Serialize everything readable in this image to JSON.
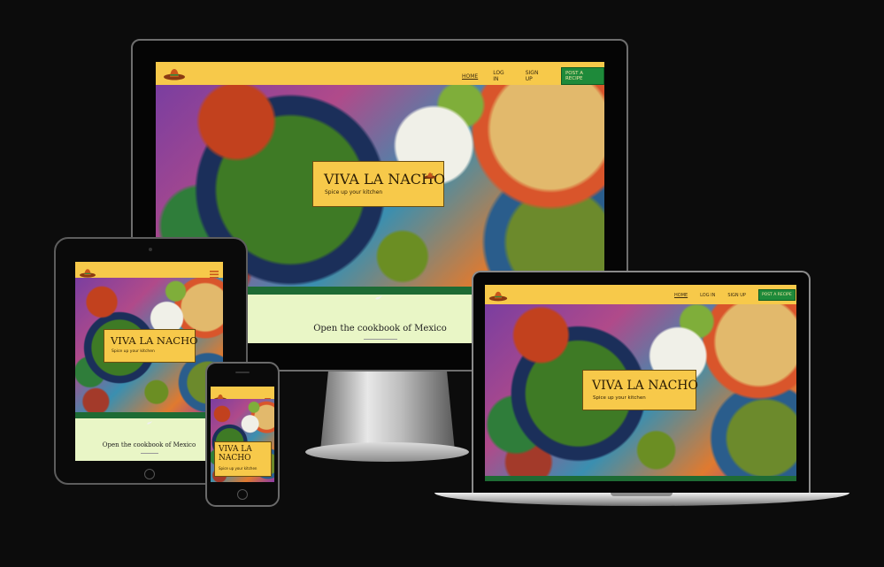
{
  "site": {
    "nav": {
      "home": "HOME",
      "login": "LOG IN",
      "signup": "SIGN UP",
      "post": "POST A RECIPE"
    },
    "hero": {
      "title": "VIVA LA NACHO",
      "title_line1": "VIVA LA",
      "title_line2": "NACHO",
      "subtitle": "Spice up your kitchen"
    },
    "tagline": "Open the cookbook of Mexico"
  },
  "icons": {
    "logo": "sombrero-logo-icon",
    "menu": "hamburger-menu-icon",
    "divider": "chili-pepper-icon"
  },
  "colors": {
    "background": "#0c0c0c",
    "nav": "#f7c94a",
    "button": "#1e8a3a",
    "strip": "#1e6b34",
    "content": "#e9f6c6"
  }
}
